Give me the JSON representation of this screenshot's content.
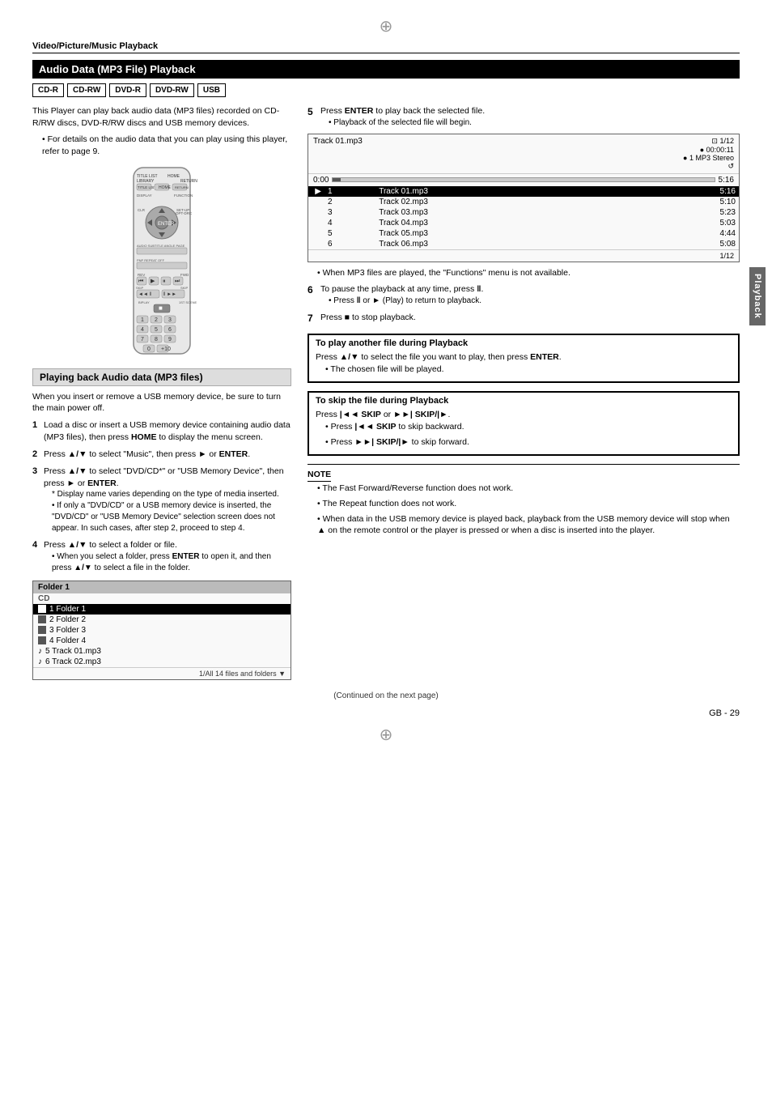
{
  "page": {
    "section": "Video/Picture/Music Playback",
    "title": "Audio Data (MP3 File) Playback",
    "page_number": "29",
    "continued_text": "(Continued on the next page)",
    "page_num_display": "GB - 29"
  },
  "disc_badges": [
    "CD-R",
    "CD-RW",
    "DVD-R",
    "DVD-RW",
    "USB"
  ],
  "intro": {
    "text": "This Player can play back audio data (MP3 files) recorded on CD-R/RW discs, DVD-R/RW discs and USB memory devices.",
    "bullet": "For details on the audio data that you can play using this player, refer to page 9."
  },
  "playing_back_section": {
    "title": "Playing back Audio data (MP3 files)",
    "warning": "When you insert or remove a USB memory device, be sure to turn the main power off.",
    "steps": [
      {
        "num": "1",
        "text": "Load a disc or insert a USB memory device containing audio data (MP3 files), then press HOME to display the menu screen."
      },
      {
        "num": "2",
        "text": "Press ▲/▼ to select \"Music\", then press ► or ENTER."
      },
      {
        "num": "3",
        "text": "Press ▲/▼ to select \"DVD/CD*\" or \"USB Memory Device\", then press ► or ENTER.",
        "note": "* Display name varies depending on the type of media inserted.",
        "bullet": "If only a \"DVD/CD\" or a USB memory device is inserted, the \"DVD/CD\" or \"USB Memory Device\" selection screen does not appear. In such cases, after step 2, proceed to step 4."
      },
      {
        "num": "4",
        "text": "Press ▲/▼ to select a folder or file.",
        "bullet": "When you select a folder, press ENTER to open it, and then press ▲/▼ to select a file in the folder."
      }
    ]
  },
  "folder_screen": {
    "header": "Folder 1",
    "cd_label": "CD",
    "items": [
      {
        "num": "1",
        "type": "folder",
        "name": "Folder 1",
        "selected": true
      },
      {
        "num": "2",
        "type": "folder",
        "name": "Folder 2",
        "selected": false
      },
      {
        "num": "3",
        "type": "folder",
        "name": "Folder 3",
        "selected": false
      },
      {
        "num": "4",
        "type": "folder",
        "name": "Folder 4",
        "selected": false
      },
      {
        "num": "5",
        "type": "music",
        "name": "Track 01.mp3",
        "selected": false
      },
      {
        "num": "6",
        "type": "music",
        "name": "Track 02.mp3",
        "selected": false
      }
    ],
    "footer": "1/All 14 files and folders ▼"
  },
  "right_col": {
    "step5": {
      "num": "5",
      "text": "Press ENTER to play back the selected file.",
      "bullet": "Playback of the selected file will begin."
    },
    "playback_screen": {
      "track_label": "Track 01.mp3",
      "counter_icon": "⊡",
      "track_num": "1/12",
      "clock_icon": "●",
      "time": "00:00:11",
      "bullet_icon": "●",
      "mode": "1 MP3 Stereo",
      "repeat_icon": "↺",
      "time_start": "0:00",
      "time_end": "5:16",
      "play_icon": "▶",
      "tracks": [
        {
          "num": "1",
          "name": "Track 01.mp3",
          "time": "5:16",
          "selected": true
        },
        {
          "num": "2",
          "name": "Track 02.mp3",
          "time": "5:10",
          "selected": false
        },
        {
          "num": "3",
          "name": "Track 03.mp3",
          "time": "5:23",
          "selected": false
        },
        {
          "num": "4",
          "name": "Track 04.mp3",
          "time": "5:03",
          "selected": false
        },
        {
          "num": "5",
          "name": "Track 05.mp3",
          "time": "4:44",
          "selected": false
        },
        {
          "num": "6",
          "name": "Track 06.mp3",
          "time": "5:08",
          "selected": false
        }
      ],
      "footer": "1/12"
    },
    "step5_note": "When MP3 files are played, the \"Functions\" menu is not available.",
    "step6": {
      "num": "6",
      "text": "To pause the playback at any time, press ‖.",
      "bullet": "Press ‖ or ► (Play) to return to playback."
    },
    "step7": {
      "num": "7",
      "text": "Press ■ to stop playback."
    },
    "play_another": {
      "title": "To play another file during Playback",
      "text": "Press ▲/▼ to select the file you want to play, then press ENTER.",
      "bullet": "The chosen file will be played."
    },
    "skip_section": {
      "title": "To skip the file during Playback",
      "text": "Press |◄◄ SKIP or ►►| SKIP/|►.",
      "bullet1": "Press |◄◄ SKIP to skip backward.",
      "bullet2": "Press ►►| SKIP/|► to skip forward."
    },
    "note": {
      "title": "NOTE",
      "items": [
        "The Fast Forward/Reverse function does not work.",
        "The Repeat function does not work.",
        "When data in the USB memory device is played back, playback from the USB memory device will stop when ▲ on the remote control or the player is pressed or when a disc is inserted into the player."
      ]
    },
    "playback_tab": "Playback"
  }
}
